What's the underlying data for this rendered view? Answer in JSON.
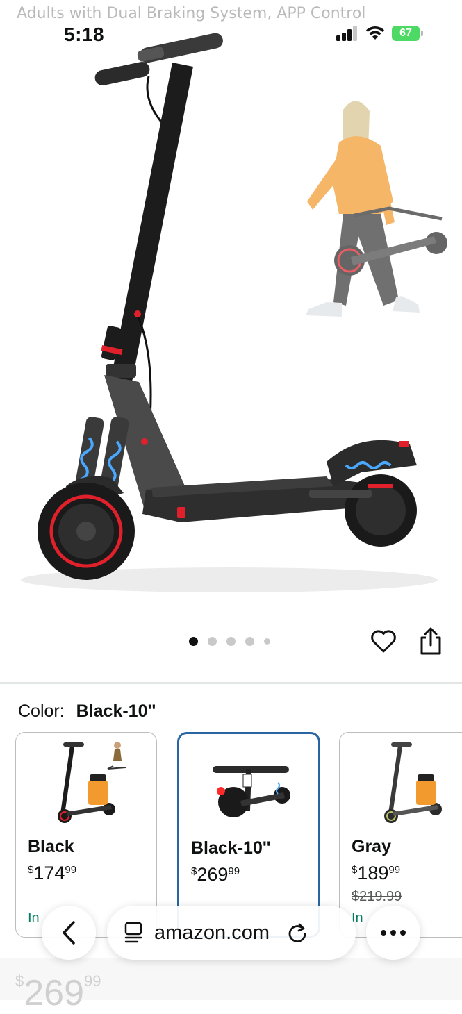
{
  "page": {
    "top_title": "Adults with Dual Braking System, APP Control"
  },
  "status_bar": {
    "time": "5:18",
    "battery": "67",
    "icons": [
      "signal-icon",
      "wifi-icon",
      "battery-icon"
    ]
  },
  "gallery": {
    "image_count": 5,
    "active_index": 0,
    "actions": [
      "heart-icon",
      "share-icon"
    ]
  },
  "color": {
    "label": "Color:",
    "selected": "Black-10''",
    "options": [
      {
        "name": "Black",
        "price_symbol": "$",
        "price_whole": "174",
        "price_cents": "99",
        "list_price": "",
        "stock": "In"
      },
      {
        "name": "Black-10''",
        "price_symbol": "$",
        "price_whole": "269",
        "price_cents": "99",
        "list_price": "",
        "stock": ""
      },
      {
        "name": "Gray",
        "price_symbol": "$",
        "price_whole": "189",
        "price_cents": "99",
        "list_price": "$219.99",
        "stock": "In"
      }
    ]
  },
  "browser": {
    "url": "amazon.com"
  },
  "bottom": {
    "price_symbol": "$",
    "price_whole": "269",
    "price_cents": "99"
  },
  "colors": {
    "accent_selected": "#2a65a3",
    "in_stock": "#067d62",
    "scooter_body": "#2b2b2b",
    "scooter_red": "#e0212b",
    "hoodie": "#f29a2e",
    "battery": "#4cd964"
  }
}
